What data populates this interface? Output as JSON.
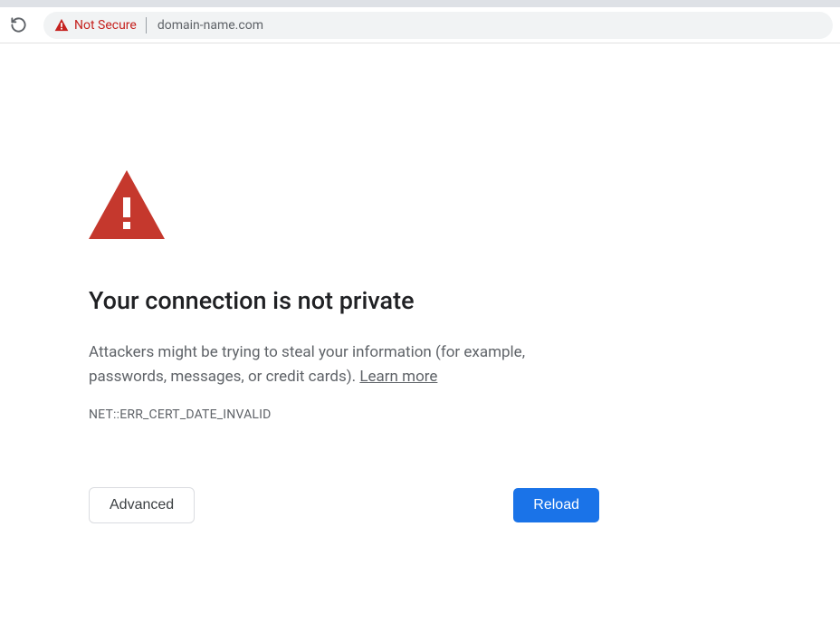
{
  "addressBar": {
    "notSecureLabel": "Not Secure",
    "url": "domain-name.com"
  },
  "page": {
    "heading": "Your connection is not private",
    "bodyText": "Attackers might be trying to steal your information (for example, passwords, messages, or credit cards). ",
    "learnMoreLabel": "Learn more",
    "errorCode": "NET::ERR_CERT_DATE_INVALID",
    "advancedLabel": "Advanced",
    "reloadLabel": "Reload"
  },
  "colors": {
    "dangerRed": "#c5221f",
    "primaryBlue": "#1a73e8"
  }
}
